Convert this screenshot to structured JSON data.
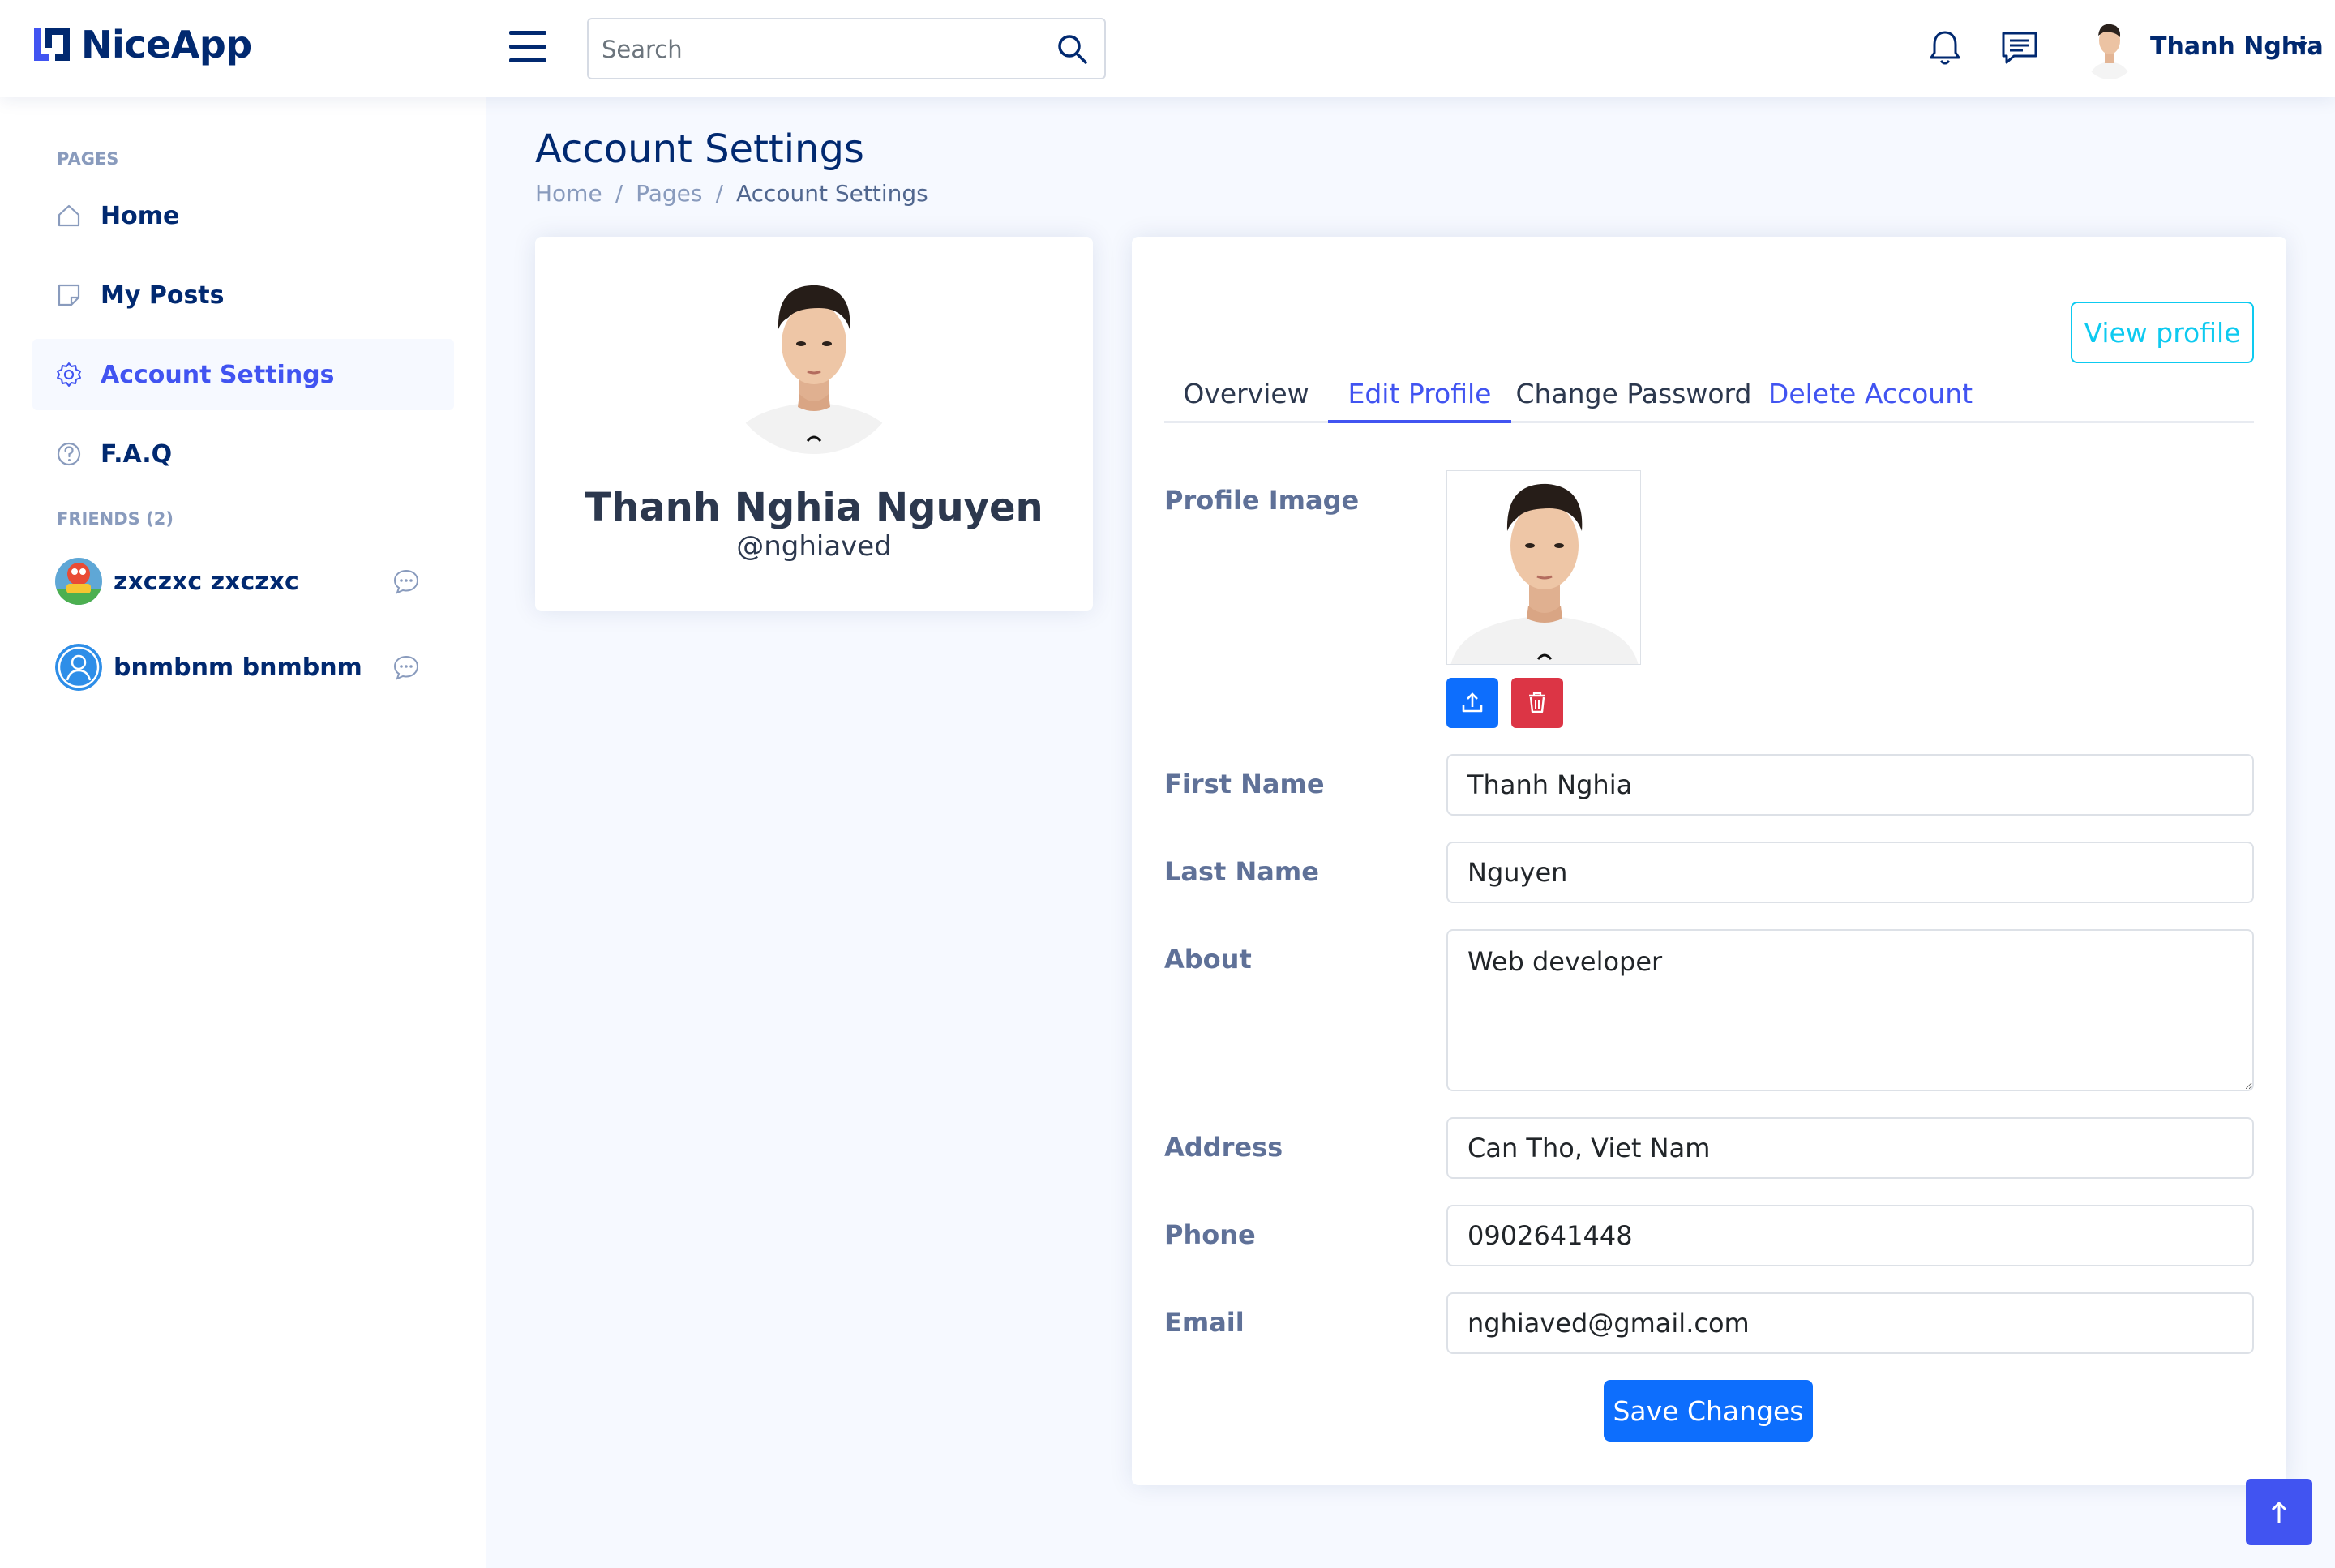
{
  "app": {
    "name": "NiceApp"
  },
  "header": {
    "search_placeholder": "Search",
    "user_name": "Thanh Nghia"
  },
  "sidebar": {
    "pages_heading": "PAGES",
    "items": [
      {
        "label": "Home",
        "icon": "house-icon"
      },
      {
        "label": "My Posts",
        "icon": "journal-icon"
      },
      {
        "label": "Account Settings",
        "icon": "gear-icon",
        "active": true
      },
      {
        "label": "F.A.Q",
        "icon": "question-circle-icon"
      }
    ],
    "friends_heading": "FRIENDS (2)",
    "friends": [
      {
        "name": "zxczxc zxczxc"
      },
      {
        "name": "bnmbnm bnmbnm"
      }
    ]
  },
  "page": {
    "title": "Account Settings",
    "breadcrumb": [
      "Home",
      "Pages",
      "Account Settings"
    ],
    "breadcrumb_separator": "/"
  },
  "profile_card": {
    "name": "Thanh Nghia Nguyen",
    "handle": "@nghiaved"
  },
  "settings": {
    "view_profile_label": "View profile",
    "tabs": [
      {
        "label": "Overview"
      },
      {
        "label": "Edit Profile",
        "active": true
      },
      {
        "label": "Change Password"
      },
      {
        "label": "Delete Account"
      }
    ],
    "fields": {
      "profile_image_label": "Profile Image",
      "first_name_label": "First Name",
      "first_name_value": "Thanh Nghia",
      "last_name_label": "Last Name",
      "last_name_value": "Nguyen",
      "about_label": "About",
      "about_value": "Web developer",
      "address_label": "Address",
      "address_value": "Can Tho, Viet Nam",
      "phone_label": "Phone",
      "phone_value": "0902641448",
      "email_label": "Email",
      "email_value": "nghiaved@gmail.com"
    },
    "save_label": "Save Changes"
  },
  "colors": {
    "primary": "#4154f1",
    "navy": "#012970",
    "info": "#0dcaf0",
    "button_blue": "#0d6efd",
    "danger": "#dc3545",
    "background": "#f6f9ff"
  }
}
